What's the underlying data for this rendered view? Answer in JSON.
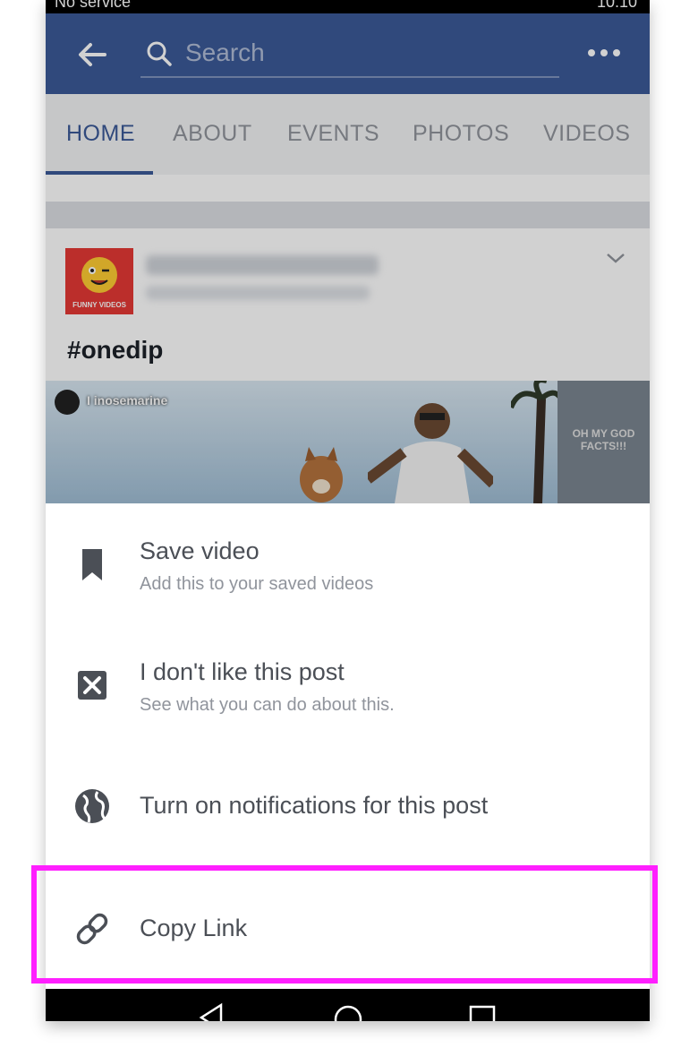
{
  "status_bar": {
    "left": "No service",
    "right": "10:10"
  },
  "search": {
    "placeholder": "Search"
  },
  "tabs": [
    {
      "label": "HOME",
      "active": true
    },
    {
      "label": "ABOUT",
      "active": false
    },
    {
      "label": "EVENTS",
      "active": false
    },
    {
      "label": "PHOTOS",
      "active": false
    },
    {
      "label": "VIDEOS",
      "active": false
    }
  ],
  "post": {
    "avatar_label": "FUNNY VIDEOS",
    "hashtag": "#onedip",
    "video_channel": "I inosemarine",
    "side_thumb_text": "OH MY GOD FACTS!!!"
  },
  "menu": {
    "items": [
      {
        "title": "Save video",
        "subtitle": "Add this to your saved videos",
        "icon": "bookmark-icon"
      },
      {
        "title": "I don't like this post",
        "subtitle": "See what you can do about this.",
        "icon": "close-box-icon"
      },
      {
        "title": "Turn on notifications for this post",
        "icon": "globe-icon"
      },
      {
        "title": "Copy Link",
        "icon": "link-icon"
      }
    ]
  },
  "colors": {
    "brand": "#3b5998",
    "highlight": "#ff1fff",
    "icon": "#4b4f56"
  }
}
